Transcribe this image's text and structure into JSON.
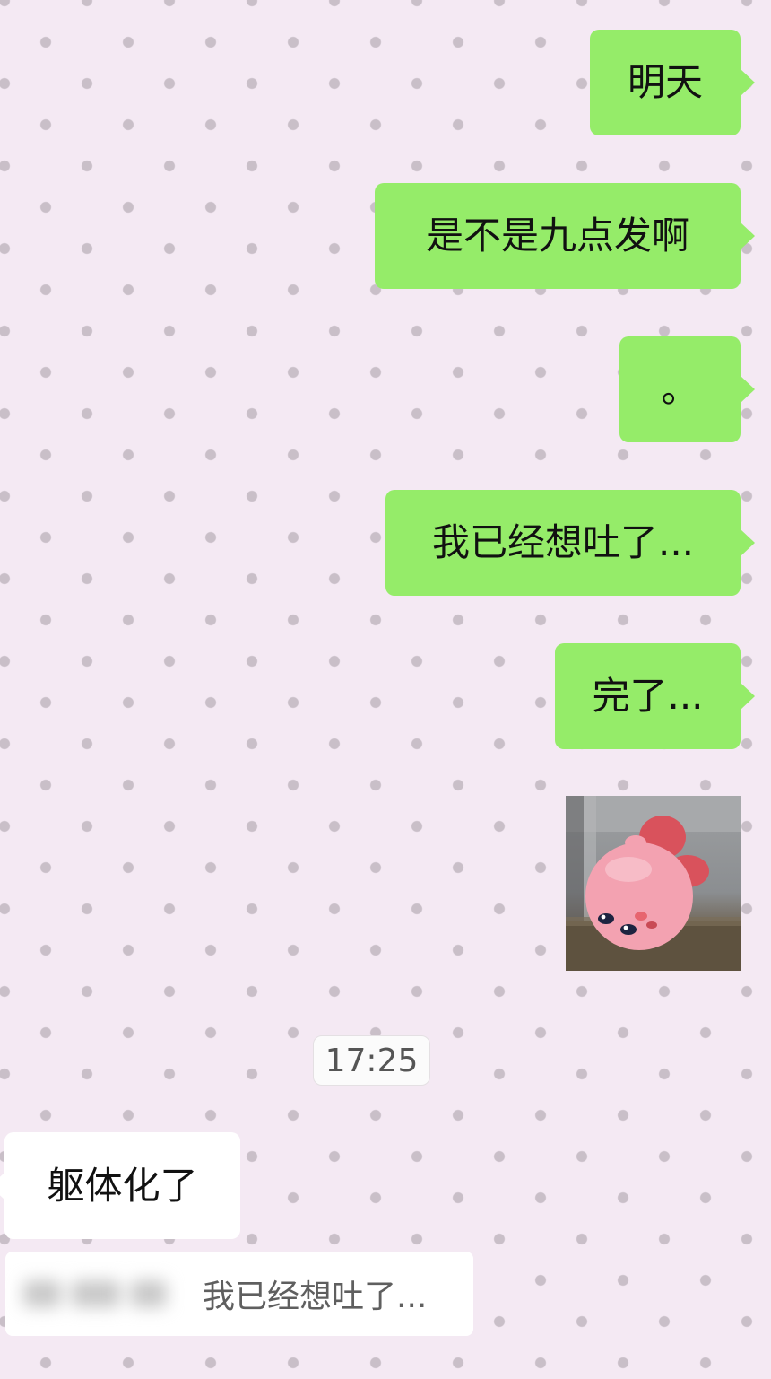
{
  "messages": [
    {
      "direction": "out",
      "text": "明天"
    },
    {
      "direction": "out",
      "text": "是不是九点发啊"
    },
    {
      "direction": "out",
      "text": "。"
    },
    {
      "direction": "out",
      "text": "我已经想吐了..."
    },
    {
      "direction": "out",
      "text": "完了..."
    },
    {
      "direction": "in",
      "text": "躯体化了"
    }
  ],
  "sticker": {
    "icon": "kirby-sticker-icon",
    "colors": {
      "body": "#f3a2b1",
      "feet": "#d9525c",
      "eyes": "#1d2340",
      "cheek": "#e7656f"
    }
  },
  "timestamp": "17:25",
  "quote": {
    "text": "我已经想吐了..."
  },
  "colors": {
    "outgoing_bubble": "#95ec69",
    "incoming_bubble": "#ffffff",
    "background": "#f4e9f3",
    "dots": "#c9bfc8"
  }
}
